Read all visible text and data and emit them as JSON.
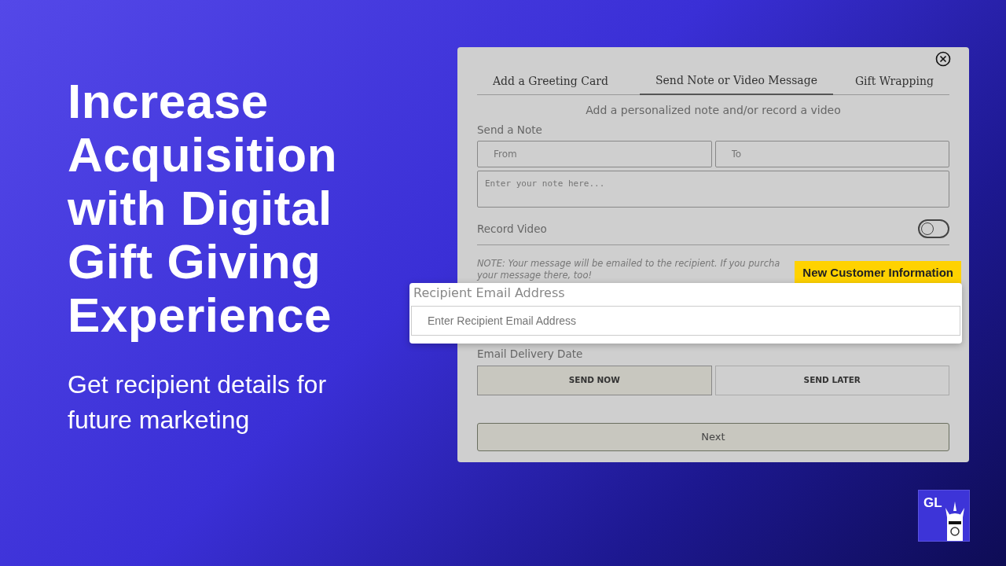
{
  "headline": "Increase Acquisition with Digital Gift Giving Experience",
  "subheadline": "Get recipient details for future marketing",
  "modal": {
    "tabs": [
      {
        "label": "Add a Greeting Card",
        "selected": false
      },
      {
        "label": "Send Note or Video Message",
        "selected": true
      },
      {
        "label": "Gift Wrapping",
        "selected": false
      }
    ],
    "intro": "Add a personalized note and/or record a video",
    "note_heading": "Send a Note",
    "from": {
      "placeholder": "From"
    },
    "to": {
      "placeholder": "To"
    },
    "message": {
      "placeholder": "Enter your note here..."
    },
    "record_video": {
      "label": "Record Video",
      "on": false
    },
    "notice_lines": [
      "NOTE: Your message will be emailed to the recipient. If you purcha",
      "your message there, too!"
    ],
    "delivery_heading": "Email Delivery Date",
    "delivery_options": [
      {
        "label": "SEND NOW",
        "selected": true
      },
      {
        "label": "SEND LATER",
        "selected": false
      }
    ],
    "next_button": "Next"
  },
  "callout": {
    "badge": "New Customer Information",
    "label": "Recipient Email Address",
    "field": {
      "placeholder": "Enter Recipient Email Address"
    }
  },
  "logo": {
    "text": "GL"
  }
}
